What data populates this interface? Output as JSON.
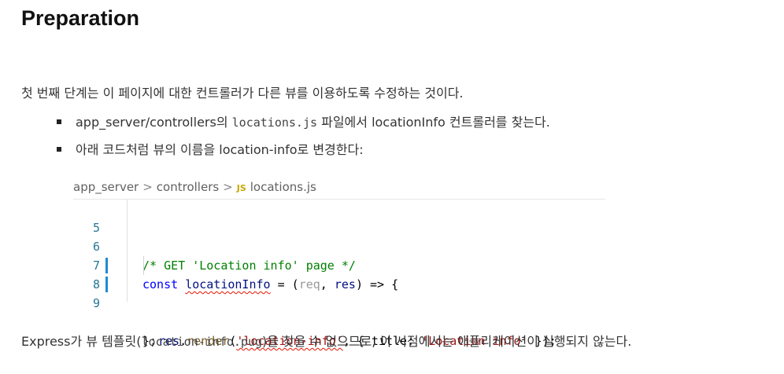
{
  "heading": "Preparation",
  "intro": "첫 번째 단계는 이 페이지에 대한 컨트롤러가 다른 뷰를 이용하도록 수정하는 것이다.",
  "bullets": [
    {
      "pre": "app_server/controllers의 ",
      "code": "locations.js",
      "post": " 파일에서 locationInfo 컨트롤러를 찾는다."
    },
    {
      "text": "아래 코드처럼 뷰의 이름을 location-info로 변경한다:"
    }
  ],
  "breadcrumb": {
    "part1": "app_server",
    "part2": "controllers",
    "js_badge": "JS",
    "file": "locations.js",
    "separator": ">"
  },
  "code_lines": [
    {
      "num": "5"
    },
    {
      "num": "6",
      "comment": "/* GET 'Location info' page */"
    },
    {
      "num": "7",
      "kw": "const",
      "name": "locationInfo",
      "eq": " = (",
      "p1": "req",
      "comma": ", ",
      "p2": "res",
      "arrow": ") => {"
    },
    {
      "num": "8",
      "obj": "res",
      "dot": ".",
      "fn": "render",
      "open": "(",
      "str1": "'location-info'",
      "mid": ", { title: ",
      "str2": "'Location info'",
      "close": " });"
    },
    {
      "num": "9",
      "text": "};"
    }
  ],
  "colors": {
    "keyword": "#0000ff",
    "string": "#a31515",
    "comment": "#008000",
    "line_number": "#237893",
    "change_marker": "#1f8ad2"
  },
  "footer": {
    "pre": "Express가 뷰 템플릿(",
    "code": "location-info.pug",
    "post": ")을 찾을 수 없으므로, 이 시점에서는 애플리케이션이  실행되지 않는다."
  }
}
